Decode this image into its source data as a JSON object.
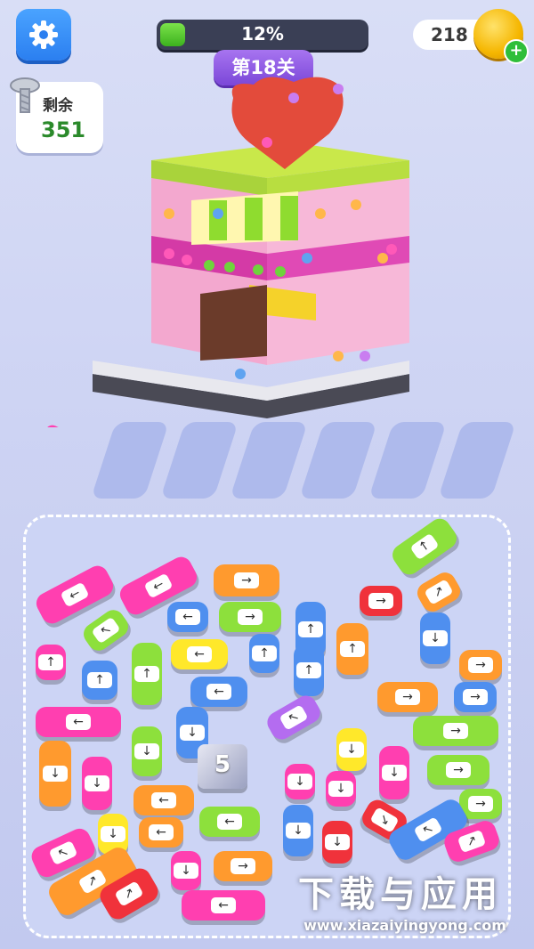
{
  "hud": {
    "progress_text": "12%",
    "progress_fraction": 0.12,
    "level_label": "第18关",
    "coins": "218",
    "remaining_label": "剩余",
    "remaining_value": "351",
    "settings_icon": "gear-icon",
    "coin_icon": "coin-icon",
    "plus_icon": "plus-icon",
    "screw_icon": "screw-icon"
  },
  "colors": {
    "orange": "#ff9a2e",
    "magenta": "#ff3fb0",
    "green": "#8de03c",
    "blue": "#4f8fef",
    "red": "#f0323b",
    "yellow": "#ffe82a",
    "purple": "#b46cf0"
  },
  "board": {
    "blocks": [
      {
        "color": "magenta",
        "arrow": "←"
      },
      {
        "color": "magenta",
        "arrow": "←"
      },
      {
        "color": "orange",
        "arrow": "→"
      },
      {
        "color": "green",
        "arrow": "↑"
      },
      {
        "color": "orange",
        "arrow": "↗"
      },
      {
        "color": "green",
        "arrow": "↖"
      },
      {
        "color": "blue",
        "arrow": "←"
      },
      {
        "color": "green",
        "arrow": "→"
      },
      {
        "color": "blue",
        "arrow": "↑"
      },
      {
        "color": "red",
        "arrow": "→"
      },
      {
        "color": "magenta",
        "arrow": "↑"
      },
      {
        "color": "blue",
        "arrow": "↑"
      },
      {
        "color": "blue",
        "arrow": "↑"
      },
      {
        "color": "orange",
        "arrow": "↑"
      },
      {
        "color": "blue",
        "arrow": "↓"
      },
      {
        "color": "orange",
        "arrow": "→"
      },
      {
        "color": "yellow",
        "arrow": "←"
      },
      {
        "color": "green",
        "arrow": "↑"
      },
      {
        "color": "blue",
        "arrow": "↑"
      },
      {
        "color": "blue",
        "arrow": "←"
      },
      {
        "color": "orange",
        "arrow": "→"
      },
      {
        "color": "blue",
        "arrow": "→"
      },
      {
        "color": "magenta",
        "arrow": "←"
      },
      {
        "color": "purple",
        "arrow": "↖"
      },
      {
        "color": "blue",
        "arrow": "↓"
      },
      {
        "color": "green",
        "arrow": "↓"
      },
      {
        "color": "green",
        "arrow": "→"
      },
      {
        "color": "yellow",
        "arrow": "↓"
      },
      {
        "color": "orange",
        "arrow": "↓"
      },
      {
        "color": "magenta",
        "arrow": "↓"
      },
      {
        "color": "magenta",
        "arrow": "↓"
      },
      {
        "color": "magenta",
        "arrow": "↓"
      },
      {
        "color": "green",
        "arrow": "→"
      },
      {
        "color": "orange",
        "arrow": "←"
      },
      {
        "color": "green",
        "arrow": "←"
      },
      {
        "color": "yellow",
        "arrow": "↓"
      },
      {
        "color": "magenta",
        "arrow": "↓"
      },
      {
        "color": "red",
        "arrow": "↘"
      },
      {
        "color": "green",
        "arrow": "→"
      },
      {
        "color": "blue",
        "arrow": "↓"
      },
      {
        "color": "red",
        "arrow": "↓"
      },
      {
        "color": "blue",
        "arrow": "↖"
      },
      {
        "color": "magenta",
        "arrow": "↖"
      },
      {
        "color": "orange",
        "arrow": "←"
      },
      {
        "color": "magenta",
        "arrow": "↗"
      },
      {
        "color": "orange",
        "arrow": "↗"
      },
      {
        "color": "magenta",
        "arrow": "↓"
      },
      {
        "color": "orange",
        "arrow": "→"
      },
      {
        "color": "red",
        "arrow": "↗"
      },
      {
        "color": "magenta",
        "arrow": "←"
      }
    ],
    "mystery_count": "5"
  },
  "watermark": {
    "title": "下载与应用",
    "url": "www.xiazaiyingyong.com"
  }
}
